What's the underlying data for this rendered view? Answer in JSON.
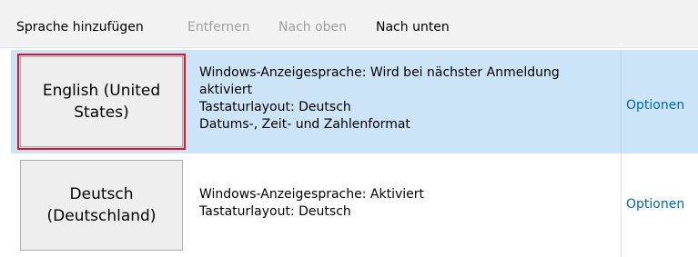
{
  "toolbar": {
    "add_label": "Sprache hinzufügen",
    "remove_label": "Entfernen",
    "up_label": "Nach oben",
    "down_label": "Nach unten"
  },
  "languages": [
    {
      "name": "English (United States)",
      "selected": true,
      "details": [
        "Windows-Anzeigesprache: Wird bei nächster Anmeldung",
        "aktiviert",
        "Tastaturlayout: Deutsch",
        "Datums-, Zeit- und Zahlenformat"
      ],
      "options_label": "Optionen"
    },
    {
      "name": "Deutsch (Deutschland)",
      "selected": false,
      "details": [
        "Windows-Anzeigesprache: Aktiviert",
        "Tastaturlayout: Deutsch"
      ],
      "options_label": "Optionen"
    }
  ],
  "colors": {
    "selected_row": "#cce4f7",
    "link": "#0066b4",
    "focus_border": "#e81123",
    "disabled_text": "#a0a0a0"
  }
}
